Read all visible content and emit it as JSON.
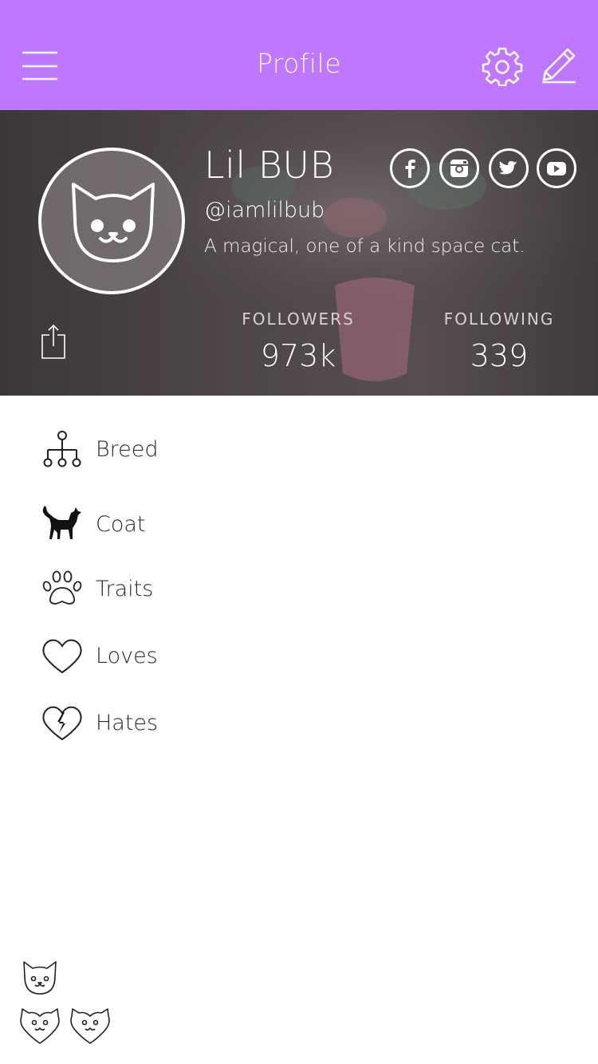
{
  "header": {
    "title": "Profile",
    "background": "#bf77ff",
    "menu_icon": "hamburger-menu-icon",
    "settings_icon": "gear-icon",
    "edit_icon": "pencil-icon"
  },
  "profile": {
    "name": "Lil BUB",
    "handle": "@iamlilbub",
    "bio": "A magical, one of a kind space cat.",
    "avatar_icon": "cat-face-icon",
    "social": [
      {
        "name": "facebook",
        "icon": "facebook-icon"
      },
      {
        "name": "instagram",
        "icon": "instagram-icon"
      },
      {
        "name": "twitter",
        "icon": "twitter-icon"
      },
      {
        "name": "youtube",
        "icon": "youtube-icon"
      }
    ],
    "share_icon": "share-icon",
    "stats": {
      "followers_label": "FOLLOWERS",
      "followers_value": "973k",
      "following_label": "FOLLOWING",
      "following_value": "339"
    }
  },
  "menu": {
    "items": [
      {
        "label": "Breed",
        "icon": "hierarchy-icon"
      },
      {
        "label": "Coat",
        "icon": "black-cat-icon"
      },
      {
        "label": "Traits",
        "icon": "paw-icon"
      },
      {
        "label": "Loves",
        "icon": "heart-icon"
      },
      {
        "label": "Hates",
        "icon": "broken-heart-icon"
      }
    ]
  },
  "footer": {
    "icons": [
      "cat-face-icon",
      "cat-heart-icon",
      "cat-heart-icon"
    ]
  }
}
